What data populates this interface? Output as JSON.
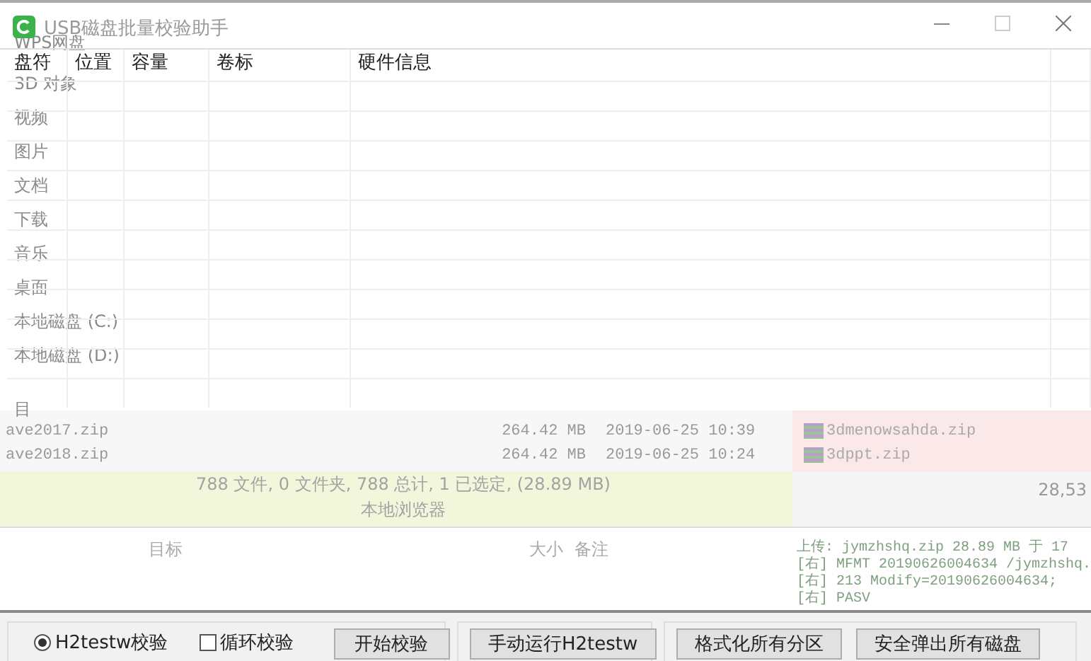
{
  "background_window": {
    "sidebar": {
      "items": [
        "WPS网盘",
        "3D 对象",
        "视频",
        "图片",
        "文档",
        "下载",
        "音乐",
        "桌面",
        "本地磁盘 (C:)",
        "本地磁盘 (D:)",
        "目"
      ]
    },
    "local_files": [
      {
        "name": "ave2017.zip",
        "size": "264.42 MB",
        "modified": "2019-06-25 10:39"
      },
      {
        "name": "ave2018.zip",
        "size": "264.42 MB",
        "modified": "2019-06-25 10:24"
      }
    ],
    "remote_files": [
      "3dmenowsahda.zip",
      "3dppt.zip"
    ],
    "status": {
      "summary": "788 文件, 0 文件夹, 788 总计, 1 已选定, (28.89 MB)",
      "location": "本地浏览器",
      "remote_size": "28,53"
    },
    "queue_columns": [
      "目标",
      "大小",
      "备注"
    ],
    "log": [
      "上传: jymzhshq.zip 28.89 MB 于 17",
      "[右] MFMT 20190626004634 /jymzhshq.",
      "[右] 213 Modify=20190626004634;",
      "[右] PASV"
    ]
  },
  "window": {
    "title": "USB磁盘批量校验助手"
  },
  "disk_table": {
    "columns": [
      "盘符",
      "位置",
      "容量",
      "卷标",
      "硬件信息"
    ]
  },
  "verify_options": {
    "h2testw_radio": {
      "label": "H2testw校验",
      "selected": true
    },
    "loop_checkbox": {
      "label": "循环校验",
      "checked": false
    },
    "start_button": "开始校验"
  },
  "manual_button": "手动运行H2testw",
  "format_button": "格式化所有分区",
  "eject_button": "安全弹出所有磁盘"
}
